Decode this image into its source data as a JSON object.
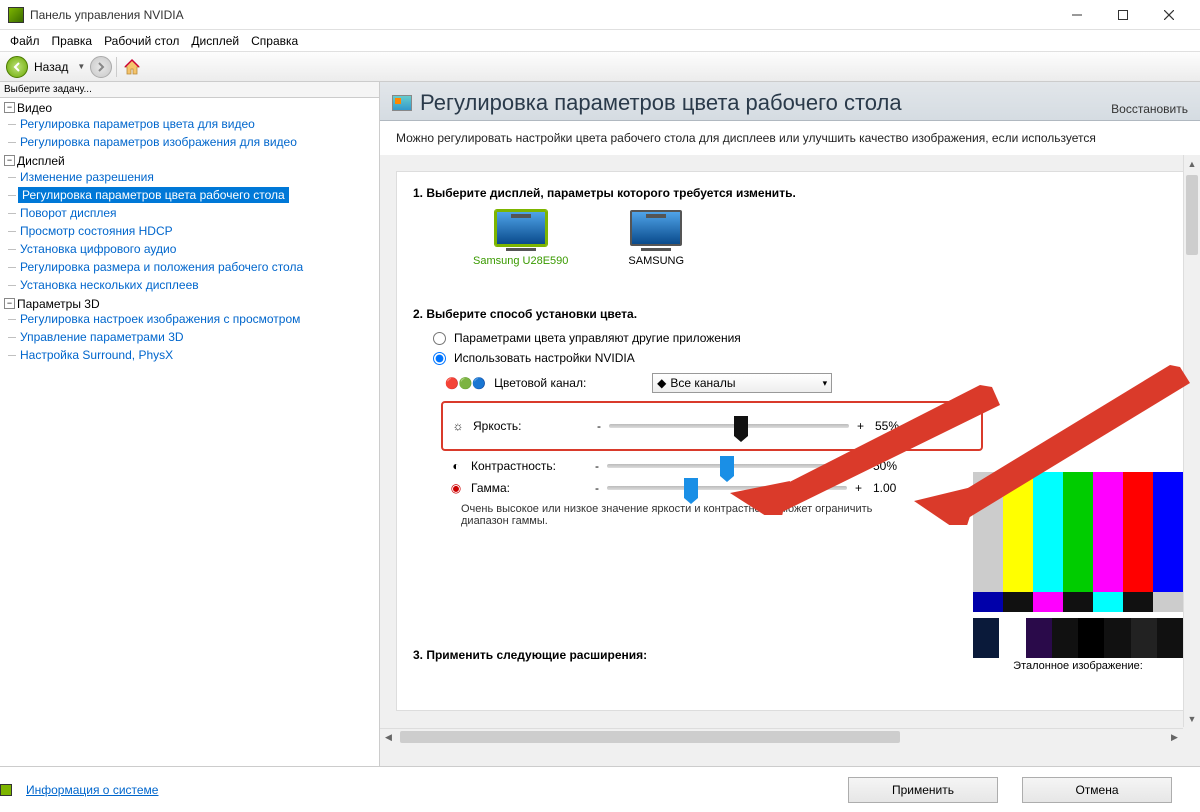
{
  "title": "Панель управления NVIDIA",
  "menu": {
    "file": "Файл",
    "edit": "Правка",
    "desktop": "Рабочий стол",
    "display": "Дисплей",
    "help": "Справка"
  },
  "toolbar": {
    "back": "Назад"
  },
  "sidebar": {
    "header": "Выберите задачу...",
    "groups": [
      {
        "label": "Видео",
        "items": [
          "Регулировка параметров цвета для видео",
          "Регулировка параметров изображения для видео"
        ]
      },
      {
        "label": "Дисплей",
        "items": [
          "Изменение разрешения",
          "Регулировка параметров цвета рабочего стола",
          "Поворот дисплея",
          "Просмотр состояния HDCP",
          "Установка цифрового аудио",
          "Регулировка размера и положения рабочего стола",
          "Установка нескольких дисплеев"
        ],
        "selected": 1
      },
      {
        "label": "Параметры 3D",
        "items": [
          "Регулировка настроек изображения с просмотром",
          "Управление параметрами 3D",
          "Настройка Surround, PhysX"
        ]
      }
    ]
  },
  "page": {
    "heading": "Регулировка параметров цвета рабочего стола",
    "restore": "Восстановить",
    "desc": "Можно регулировать настройки цвета рабочего стола для дисплеев или улучшить качество изображения, если используется",
    "step1": "1. Выберите дисплей, параметры которого требуется изменить.",
    "displays": [
      {
        "name": "Samsung U28E590",
        "selected": true
      },
      {
        "name": "SAMSUNG",
        "selected": false
      }
    ],
    "step2": "2. Выберите способ установки цвета.",
    "radio_other": "Параметрами цвета управляют другие приложения",
    "radio_nvidia": "Использовать настройки NVIDIA",
    "channel_label": "Цветовой канал:",
    "channel_value": "Все каналы",
    "sliders": {
      "brightness": {
        "label": "Яркость:",
        "value": "55%",
        "pos": 55
      },
      "contrast": {
        "label": "Контрастность:",
        "value": "50%",
        "pos": 50
      },
      "gamma": {
        "label": "Гамма:",
        "value": "1.00",
        "pos": 35
      }
    },
    "note": "Очень высокое или низкое значение яркости и контрастности может ограничить диапазон гаммы.",
    "step3": "3. Применить следующие расширения:",
    "preview_label": "Эталонное изображение:"
  },
  "footer": {
    "sysinfo": "Информация о системе",
    "apply": "Применить",
    "cancel": "Отмена"
  }
}
